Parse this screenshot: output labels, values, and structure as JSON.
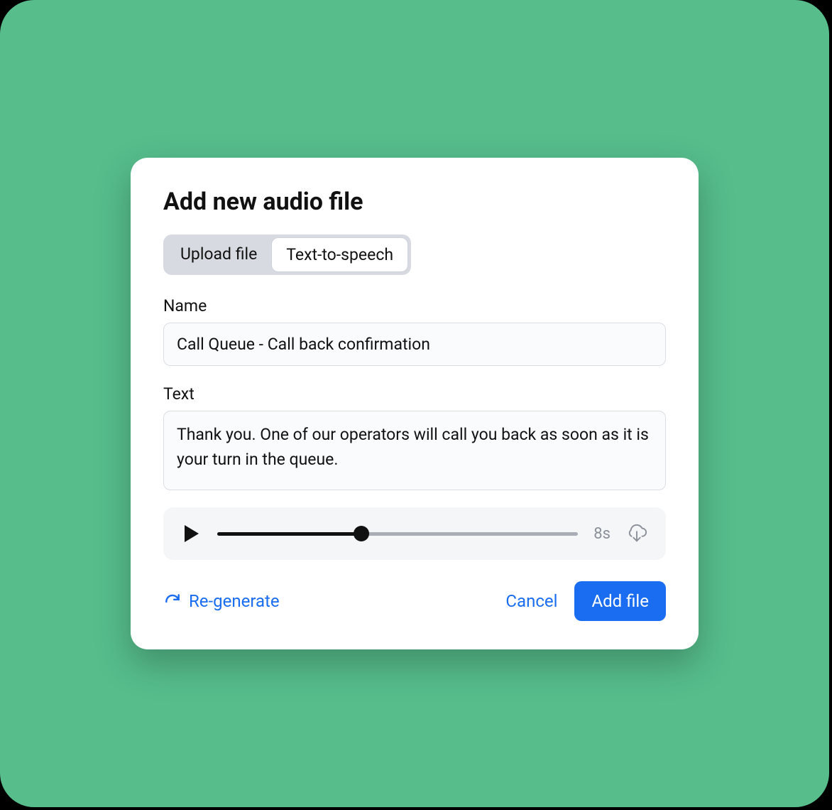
{
  "modal": {
    "title": "Add new audio file",
    "tabs": {
      "upload": "Upload file",
      "tts": "Text-to-speech"
    },
    "fields": {
      "name_label": "Name",
      "name_value": "Call Queue - Call back confirmation",
      "text_label": "Text",
      "text_value": "Thank you. One of our operators will call you back as soon as it is your turn in the queue."
    },
    "player": {
      "duration": "8s",
      "progress_percent": 40
    },
    "actions": {
      "regenerate": "Re-generate",
      "cancel": "Cancel",
      "add": "Add file"
    }
  }
}
